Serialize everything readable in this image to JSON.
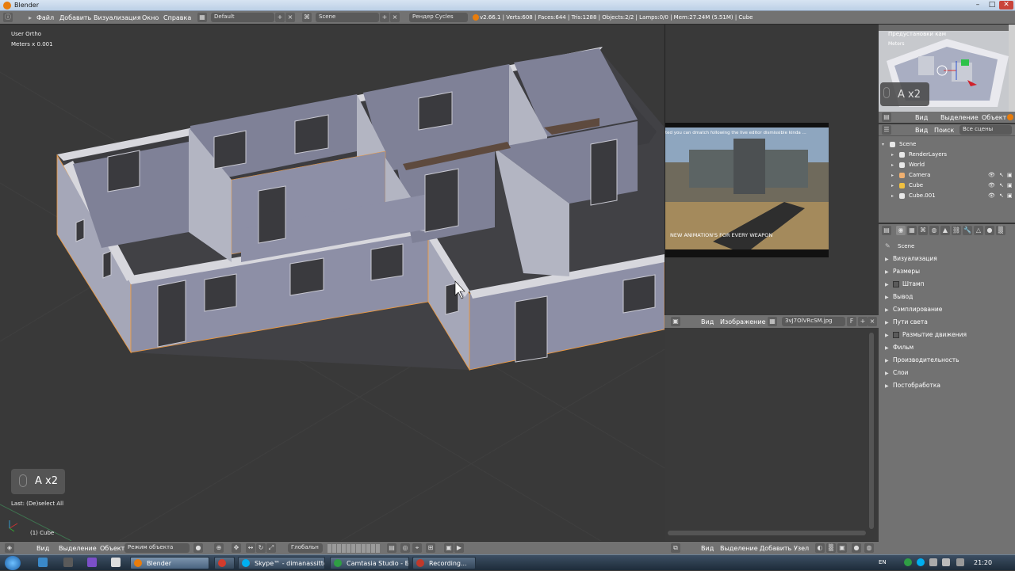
{
  "window": {
    "title": "Blender",
    "controls": [
      "–",
      "□",
      "✕"
    ]
  },
  "infobar": {
    "menus": [
      "Файл",
      "Добавить",
      "Визуализация",
      "Окно",
      "Справка"
    ],
    "layout_value": "Default",
    "scene_value": "Scene",
    "engine_value": "Рендер Cycles",
    "stats": "v2.66.1 | Verts:608 | Faces:644 | Tris:1288 | Objects:2/2 | Lamps:0/0 | Mem:27.24M (5.51M) | Cube"
  },
  "viewport": {
    "view_name": "User Ortho",
    "units": "Meters x 0.001",
    "key_display": "A x2",
    "last_operator": "Last: (De)select All",
    "object_label": "(1) Cube"
  },
  "viewport_header": {
    "items": [
      "Вид",
      "Выделение",
      "Объект"
    ],
    "mode_value": "Режим объекта",
    "orientation_value": "Глобальн"
  },
  "video_panel": {
    "caption_top": "ted you can dmatch following the live editor dismissible kinda ...",
    "caption_bottom": "NEW ANIMATION'S FOR EVERY WEAPON"
  },
  "image_editor": {
    "header_items": [
      "Вид",
      "Изображение"
    ],
    "image_name": "3vJ7OlVRcSM.jpg",
    "footer_items": [
      "Вид",
      "Выделение",
      "Добавить",
      "Узел"
    ]
  },
  "preview": {
    "title": "Предустановки кам",
    "units": "Meters",
    "key_display": "A x2"
  },
  "outliner": {
    "header_items": [
      "Вид",
      "Выделение",
      "Объект"
    ],
    "header2_items": [
      "Вид",
      "Поиск"
    ],
    "scene_filter": "Все сцены",
    "rows": [
      {
        "label": "Scene",
        "indent": 0,
        "color": "#e8e8e8"
      },
      {
        "label": "RenderLayers",
        "indent": 1,
        "color": "#e8e8e8"
      },
      {
        "label": "World",
        "indent": 1,
        "color": "#e8e8e8"
      },
      {
        "label": "Camera",
        "indent": 1,
        "color": "#f0b070"
      },
      {
        "label": "Cube",
        "indent": 1,
        "color": "#f0c040"
      },
      {
        "label": "Cube.001",
        "indent": 1,
        "color": "#e8e8e8"
      }
    ]
  },
  "properties": {
    "context": "Scene",
    "panels": [
      {
        "label": "Визуализация",
        "checkbox": false
      },
      {
        "label": "Размеры",
        "checkbox": false
      },
      {
        "label": "Штамп",
        "checkbox": true
      },
      {
        "label": "Вывод",
        "checkbox": false
      },
      {
        "label": "Сэмплирование",
        "checkbox": false
      },
      {
        "label": "Пути света",
        "checkbox": false
      },
      {
        "label": "Размытие движения",
        "checkbox": true
      },
      {
        "label": "Фильм",
        "checkbox": false
      },
      {
        "label": "Производительность",
        "checkbox": false
      },
      {
        "label": "Слои",
        "checkbox": false
      },
      {
        "label": "Постобработка",
        "checkbox": false
      }
    ]
  },
  "taskbar": {
    "tasks": [
      {
        "label": "Blender",
        "active": true,
        "color": "#e87d0d"
      },
      {
        "label": "",
        "active": false,
        "color": "#d33b2c"
      },
      {
        "label": "Skype™ - dimanassitto",
        "active": false,
        "color": "#00aff0"
      },
      {
        "label": "Camtasia Studio - Бе...",
        "active": false,
        "color": "#2f9e44"
      },
      {
        "label": "Recording...",
        "active": false,
        "color": "#c0392b"
      }
    ],
    "keyboard": "EN",
    "clock": "21:20"
  },
  "colors": {
    "header_gray": "#727272",
    "viewport_bg": "#393939",
    "wall_fill": "#8d8fa6",
    "wall_top": "#d7d7dd",
    "selection_orange": "#f39a3a"
  }
}
